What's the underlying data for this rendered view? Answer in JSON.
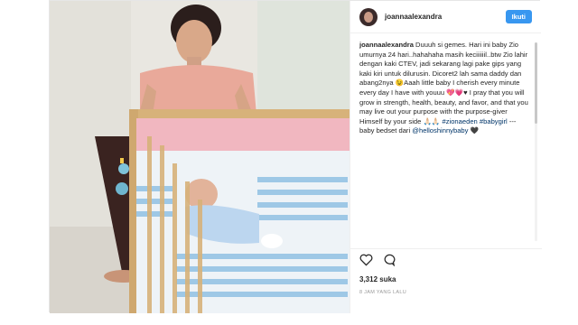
{
  "post": {
    "username": "joannaalexandra",
    "follow_label": "Ikuti",
    "caption": {
      "author": "joannaalexandra",
      "text": " Duuuh si gemes. Hari ini baby Zio umurnya 24 hari..hahahaha masih keciiiiiil..btw Zio lahir dengan kaki CTEV, jadi sekarang lagi pake gips yang kaki kiri untuk dilurusin. Dicoret2 lah sama daddy dan abang2nya 😉Aaah little baby I cherish every minute every day I have with youuu 💖💗♥ I pray that you will grow in strength, health, beauty, and favor, and that you may live out your purpose with the purpose-giver Himself by your side 🙏🏻🙏🏻 ",
      "hashtags": [
        "#zionaeden",
        "#babygirl"
      ],
      "suffix": " ---baby bedset dari ",
      "mention": "@helloshinnybaby",
      "end": " 🖤"
    },
    "likes": "3,312 suka",
    "time_ago": "8 JAM YANG LALU",
    "icons": [
      "heart-icon",
      "comment-icon"
    ]
  }
}
